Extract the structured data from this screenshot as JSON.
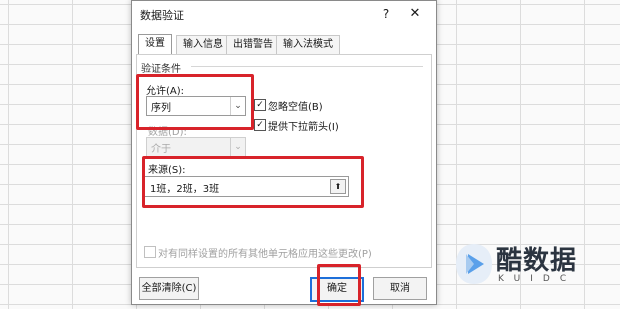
{
  "dialog": {
    "title": "数据验证",
    "help": "?",
    "close": "✕"
  },
  "tabs": [
    {
      "label": "设置",
      "active": true
    },
    {
      "label": "输入信息"
    },
    {
      "label": "出错警告"
    },
    {
      "label": "输入法模式"
    }
  ],
  "criteria": {
    "group_label": "验证条件",
    "allow_label": "允许(A):",
    "allow_value": "序列",
    "ignore_blank": {
      "label": "忽略空值(B)",
      "checked": true
    },
    "dropdown": {
      "label": "提供下拉箭头(I)",
      "checked": true
    },
    "data_label": "数据(D):",
    "data_value": "介于",
    "source_label": "来源(S):",
    "source_value": "1班，2班，3班"
  },
  "apply_all": {
    "label": "对有同样设置的所有其他单元格应用这些更改(P)",
    "checked": false
  },
  "buttons": {
    "clear_all": "全部清除(C)",
    "ok": "确定",
    "cancel": "取消"
  },
  "icons": {
    "dropdown": "chevron-down-icon",
    "collapse": "collapse-range-icon",
    "checkmark": "checkmark-icon"
  },
  "colors": {
    "highlight": "#d8232a",
    "default_button_border": "#1e6fd9"
  },
  "watermark": {
    "name": "酷数据",
    "sub": "KUIDC"
  }
}
